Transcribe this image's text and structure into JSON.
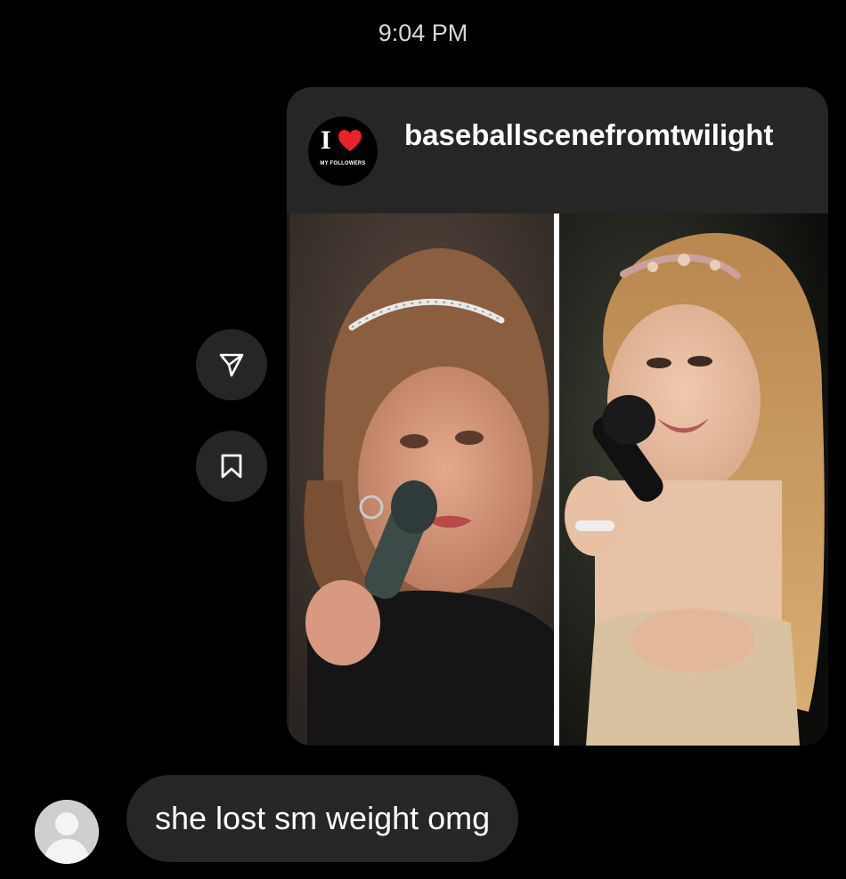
{
  "timestamp": "9:04 PM",
  "shared_post": {
    "account_avatar": {
      "logo_text": "I",
      "logo_caption": "MY FOLLOWERS",
      "icon": "heart-icon"
    },
    "username": "baseballscenefromtwilight",
    "photos": [
      {
        "name": "left-photo-woman-with-headband-and-microphone"
      },
      {
        "name": "right-photo-woman-with-flower-headband-singing"
      }
    ]
  },
  "actions": [
    {
      "name": "share-button",
      "icon": "paper-plane-icon"
    },
    {
      "name": "save-button",
      "icon": "bookmark-icon"
    }
  ],
  "message": {
    "text": "she lost sm weight omg",
    "avatar_icon": "default-avatar-icon"
  },
  "colors": {
    "background": "#000000",
    "bubble": "#262626",
    "heart": "#e8232b"
  }
}
